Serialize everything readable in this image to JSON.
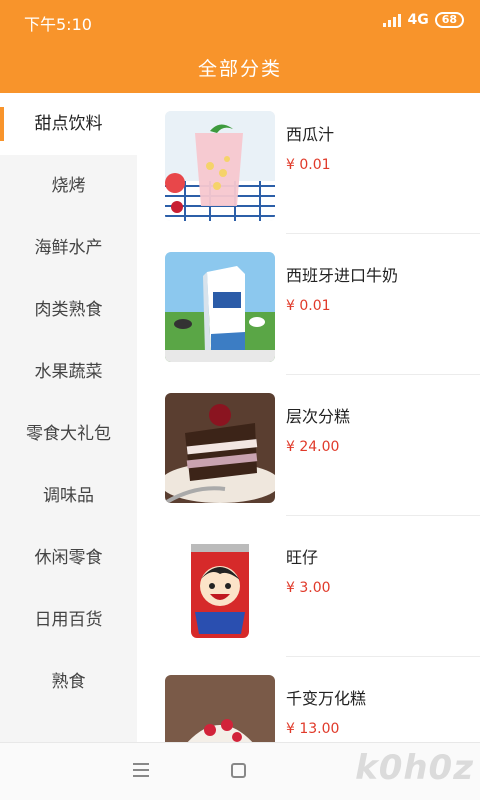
{
  "status_bar": {
    "time": "下午5:10",
    "network": "4G",
    "battery": "68"
  },
  "header": {
    "title": "全部分类"
  },
  "sidebar": {
    "items": [
      {
        "label": "甜点饮料",
        "active": true
      },
      {
        "label": "烧烤"
      },
      {
        "label": "海鲜水产"
      },
      {
        "label": "肉类熟食"
      },
      {
        "label": "水果蔬菜"
      },
      {
        "label": "零食大礼包"
      },
      {
        "label": "调味品"
      },
      {
        "label": "休闲零食"
      },
      {
        "label": "日用百货"
      },
      {
        "label": "熟食"
      }
    ]
  },
  "products": [
    {
      "name": "西瓜汁",
      "price": "¥ 0.01",
      "image": "watermelon-juice"
    },
    {
      "name": "西班牙进口牛奶",
      "price": "¥ 0.01",
      "image": "milk-carton"
    },
    {
      "name": "层次分糕",
      "price": "¥ 24.00",
      "image": "layer-cake"
    },
    {
      "name": "旺仔",
      "price": "¥ 3.00",
      "image": "wangzai-can"
    },
    {
      "name": "千变万化糕",
      "price": "¥ 13.00",
      "image": "cream-cake"
    }
  ],
  "colors": {
    "accent": "#f8942b",
    "price": "#e03a2a",
    "sidebar_bg": "#f5f5f5"
  },
  "watermark": "k0h0z"
}
